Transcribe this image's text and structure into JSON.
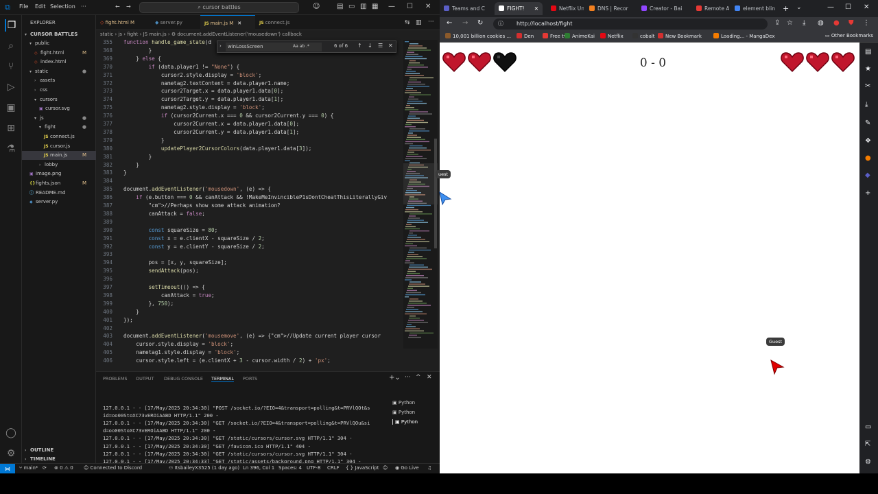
{
  "vscode": {
    "menu": [
      "File",
      "Edit",
      "Selection",
      "···"
    ],
    "search": "cursor battles",
    "explorer_title": "EXPLORER",
    "project": "CURSOR BATTLES",
    "tree": [
      {
        "label": "public",
        "kind": "folder",
        "depth": 1,
        "mod": ""
      },
      {
        "label": "fight.html",
        "kind": "html",
        "depth": 2,
        "mod": "M"
      },
      {
        "label": "index.html",
        "kind": "html",
        "depth": 2,
        "mod": ""
      },
      {
        "label": "static",
        "kind": "folder",
        "depth": 1,
        "mod": ""
      },
      {
        "label": "assets",
        "kind": "folder-closed",
        "depth": 2,
        "mod": ""
      },
      {
        "label": "css",
        "kind": "folder-closed",
        "depth": 2,
        "mod": ""
      },
      {
        "label": "cursors",
        "kind": "folder",
        "depth": 2,
        "mod": ""
      },
      {
        "label": "cursor.svg",
        "kind": "img",
        "depth": 3,
        "mod": ""
      },
      {
        "label": "js",
        "kind": "folder",
        "depth": 2,
        "mod": ""
      },
      {
        "label": "fight",
        "kind": "folder",
        "depth": 3,
        "mod": ""
      },
      {
        "label": "connect.js",
        "kind": "js",
        "depth": 4,
        "mod": ""
      },
      {
        "label": "cursor.js",
        "kind": "js",
        "depth": 4,
        "mod": ""
      },
      {
        "label": "main.js",
        "kind": "js",
        "depth": 4,
        "mod": "M"
      },
      {
        "label": "lobby",
        "kind": "folder-closed",
        "depth": 3,
        "mod": ""
      },
      {
        "label": "image.png",
        "kind": "img",
        "depth": 1,
        "mod": ""
      },
      {
        "label": "fights.json",
        "kind": "json",
        "depth": 1,
        "mod": "M"
      },
      {
        "label": "README.md",
        "kind": "md",
        "depth": 1,
        "mod": ""
      },
      {
        "label": "server.py",
        "kind": "py",
        "depth": 1,
        "mod": ""
      }
    ],
    "outline": "OUTLINE",
    "timeline": "TIMELINE",
    "tabs": [
      {
        "label": "fight.html M"
      },
      {
        "label": "server.py"
      },
      {
        "label": "main.js M"
      },
      {
        "label": "connect.js"
      }
    ],
    "breadcrumb": "static › js › fight › JS main.js › ⚙ document.addEventListener('mousedown') callback",
    "find": {
      "value": "winLossScreen",
      "options": "Aa ab .*",
      "count": "6 of 6"
    },
    "code": [
      {
        "n": "355",
        "t": "function handle_game_state(d"
      },
      {
        "n": "368",
        "t": "        }"
      },
      {
        "n": "369",
        "t": "    } else {"
      },
      {
        "n": "370",
        "t": "        if (data.player1 != \"None\") {"
      },
      {
        "n": "371",
        "t": "            cursor2.style.display = 'block';"
      },
      {
        "n": "372",
        "t": "            nametag2.textContent = data.player1.name;"
      },
      {
        "n": "373",
        "t": "            cursor2Target.x = data.player1.data[0];"
      },
      {
        "n": "374",
        "t": "            cursor2Target.y = data.player1.data[1];"
      },
      {
        "n": "375",
        "t": "            nametag2.style.display = 'block';"
      },
      {
        "n": "376",
        "t": "            if (cursor2Current.x === 0 && cursor2Current.y === 0) {"
      },
      {
        "n": "377",
        "t": "                cursor2Current.x = data.player1.data[0];"
      },
      {
        "n": "378",
        "t": "                cursor2Current.y = data.player1.data[1];"
      },
      {
        "n": "379",
        "t": "            }"
      },
      {
        "n": "380",
        "t": "            updatePlayer2CursorColors(data.player1.data[3]);"
      },
      {
        "n": "381",
        "t": "        }"
      },
      {
        "n": "382",
        "t": "    }"
      },
      {
        "n": "383",
        "t": "}"
      },
      {
        "n": "384",
        "t": ""
      },
      {
        "n": "385",
        "t": "document.addEventListener('mousedown', (e) => {"
      },
      {
        "n": "386",
        "t": "    if (e.button === 0 && canAttack && !MakeMeInvincibleP1sDontCheatThisLiterallyGiv"
      },
      {
        "n": "387",
        "t": "        //Perhaps show some attack animation?"
      },
      {
        "n": "388",
        "t": "        canAttack = false;"
      },
      {
        "n": "389",
        "t": ""
      },
      {
        "n": "390",
        "t": "        const squareSize = 80;"
      },
      {
        "n": "391",
        "t": "        const x = e.clientX - squareSize / 2;"
      },
      {
        "n": "392",
        "t": "        const y = e.clientY - squareSize / 2;"
      },
      {
        "n": "393",
        "t": ""
      },
      {
        "n": "394",
        "t": "        pos = [x, y, squareSize];"
      },
      {
        "n": "395",
        "t": "        sendAttack(pos);"
      },
      {
        "n": "396",
        "t": ""
      },
      {
        "n": "397",
        "t": "        setTimeout(() => {"
      },
      {
        "n": "398",
        "t": "            canAttack = true;"
      },
      {
        "n": "399",
        "t": "        }, 750);"
      },
      {
        "n": "400",
        "t": "    }"
      },
      {
        "n": "401",
        "t": "});"
      },
      {
        "n": "402",
        "t": ""
      },
      {
        "n": "403",
        "t": "document.addEventListener('mousemove', (e) => {//Update current player cursor"
      },
      {
        "n": "404",
        "t": "    cursor.style.display = 'block';"
      },
      {
        "n": "405",
        "t": "    nametag1.style.display = 'block';"
      },
      {
        "n": "406",
        "t": "    cursor.style.left = (e.clientX + 3 - cursor.width / 2) + 'px';"
      }
    ],
    "panel_tabs": [
      "PROBLEMS",
      "OUTPUT",
      "DEBUG CONSOLE",
      "TERMINAL",
      "PORTS"
    ],
    "terminal": [
      "127.0.0.1 - - [17/May/2025 20:34:30] \"POST /socket.io/?EIO=4&transport=polling&t=PRVlQOt&s",
      "id=oo00StoXC73vEROiAABD HTTP/1.1\" 200 -",
      "127.0.0.1 - - [17/May/2025 20:34:30] \"GET /socket.io/?EIO=4&transport=polling&t=PRVlQOu&si",
      "d=oo00StoXC73vEROiAABD HTTP/1.1\" 200 -",
      "127.0.0.1 - - [17/May/2025 20:34:30] \"GET /static/cursors/cursor.svg HTTP/1.1\" 304 -",
      "127.0.0.1 - - [17/May/2025 20:34:30] \"GET /favicon.ico HTTP/1.1\" 404 -",
      "127.0.0.1 - - [17/May/2025 20:34:30] \"GET /static/cursors/cursor.svg HTTP/1.1\" 304 -",
      "127.0.0.1 - - [17/May/2025 20:34:33] \"GET /static/assets/background.png HTTP/1.1\" 304 -",
      "127.0.0.1 - - [17/May/2025 20:34:33] \"GET /static/assets/background.png HTTP/1.1\" 200 -"
    ],
    "terminals": [
      "Python",
      "Python",
      "Python"
    ],
    "status": {
      "branch": "main*",
      "errors": "⊗ 0 ⚠ 0",
      "discord": "Connected to Discord",
      "author": "ItsbaileyX3525 (1 day ago)",
      "position": "Ln 396, Col 1",
      "spaces": "Spaces: 4",
      "encoding": "UTF-8",
      "eol": "CRLF",
      "language": "{ } JavaScript",
      "golive": "Go Live"
    }
  },
  "browser": {
    "tabs": [
      {
        "label": "Teams and C",
        "color": "#5b5fc7"
      },
      {
        "label": "FIGHT!",
        "color": "#ffffff"
      },
      {
        "label": "Netflix Unite",
        "color": "#e50914"
      },
      {
        "label": "DNS | Recor",
        "color": "#f38020"
      },
      {
        "label": "Creator - Bai",
        "color": "#9146ff"
      },
      {
        "label": "Remote Acc",
        "color": "#e53935"
      },
      {
        "label": "element blin",
        "color": "#4285f4"
      }
    ],
    "url_host": "http://localhost/fight",
    "bookmarks": [
      {
        "label": "10,001 billion cookies ...",
        "color": "#8b5a2b"
      },
      {
        "label": "Den",
        "color": "#d32f2f"
      },
      {
        "label": "Free tv",
        "color": "#e53935"
      },
      {
        "label": "AnimeKai",
        "color": "#2e7d32"
      },
      {
        "label": "Netflix",
        "color": "#e50914"
      },
      {
        "label": "cobalt",
        "color": "#333333"
      },
      {
        "label": "New Bookmark",
        "color": "#d32f2f"
      },
      {
        "label": "Loading... - MangaDex",
        "color": "#f57c00"
      }
    ],
    "other_bookmarks": "Other Bookmarks",
    "game": {
      "score": "0 - 0",
      "player_hearts": [
        "full",
        "full",
        "empty"
      ],
      "opponent_hearts": [
        "full",
        "full",
        "full"
      ],
      "heart_color": "#c0162c",
      "tag_left": "uest",
      "tag_right": "Guest"
    }
  }
}
